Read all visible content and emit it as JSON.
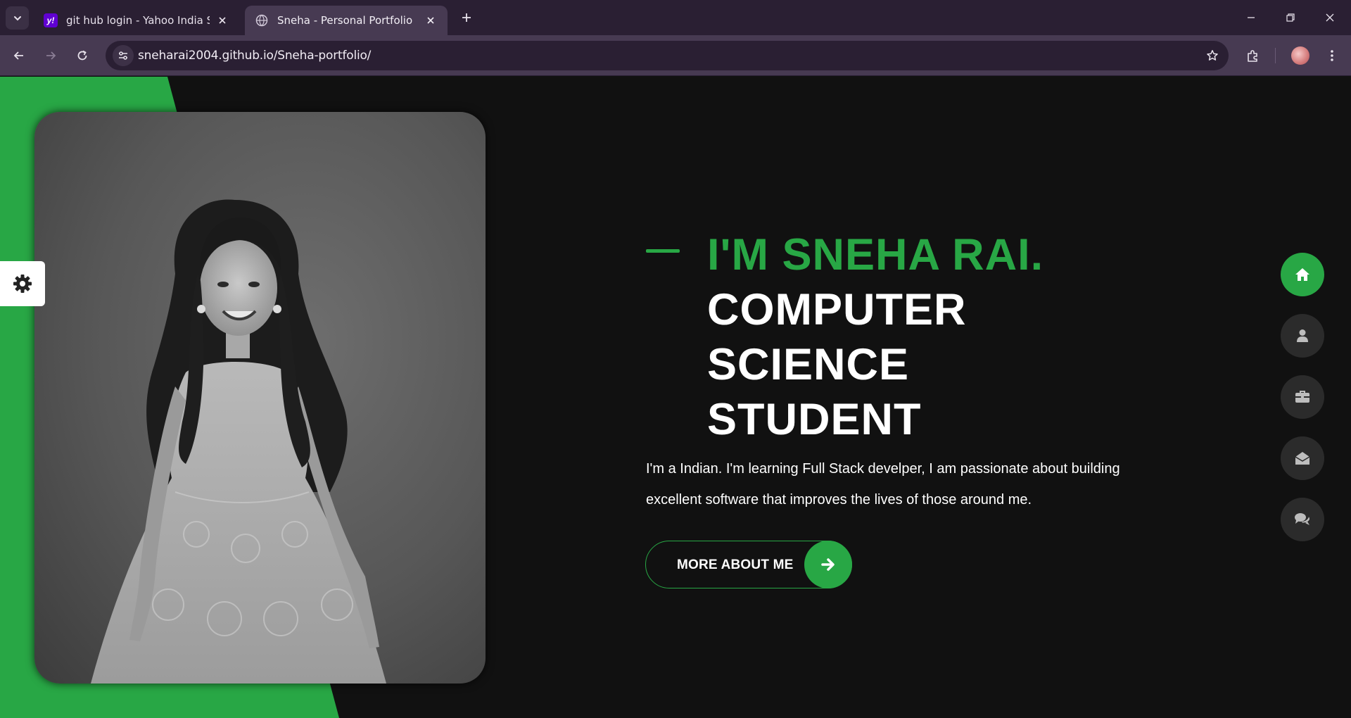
{
  "browser": {
    "tabs": [
      {
        "title": "git hub login - Yahoo India Sear",
        "favicon": "yahoo-icon",
        "active": false
      },
      {
        "title": "Sneha - Personal Portfolio",
        "favicon": "globe-icon",
        "active": true
      }
    ],
    "url": "sneharai2004.github.io/Sneha-portfolio/"
  },
  "hero": {
    "intro": "I'M SNEHA RAI.",
    "role_lines": [
      "COMPUTER",
      "SCIENCE",
      "STUDENT"
    ],
    "bio_line1": "I'm a Indian. I'm learning Full Stack develper, I am passionate about building",
    "bio_line2": "excellent software that improves the lives of those around me.",
    "cta_label": "MORE ABOUT ME"
  },
  "side_nav": [
    {
      "icon": "home-icon",
      "active": true
    },
    {
      "icon": "user-icon",
      "active": false
    },
    {
      "icon": "briefcase-icon",
      "active": false
    },
    {
      "icon": "envelope-open-icon",
      "active": false
    },
    {
      "icon": "comments-icon",
      "active": false
    }
  ],
  "colors": {
    "accent": "#28a745",
    "background": "#111111",
    "nav_inactive": "#2b2b2b",
    "browser_frame": "#2a1f33",
    "browser_toolbar": "#473a52"
  }
}
